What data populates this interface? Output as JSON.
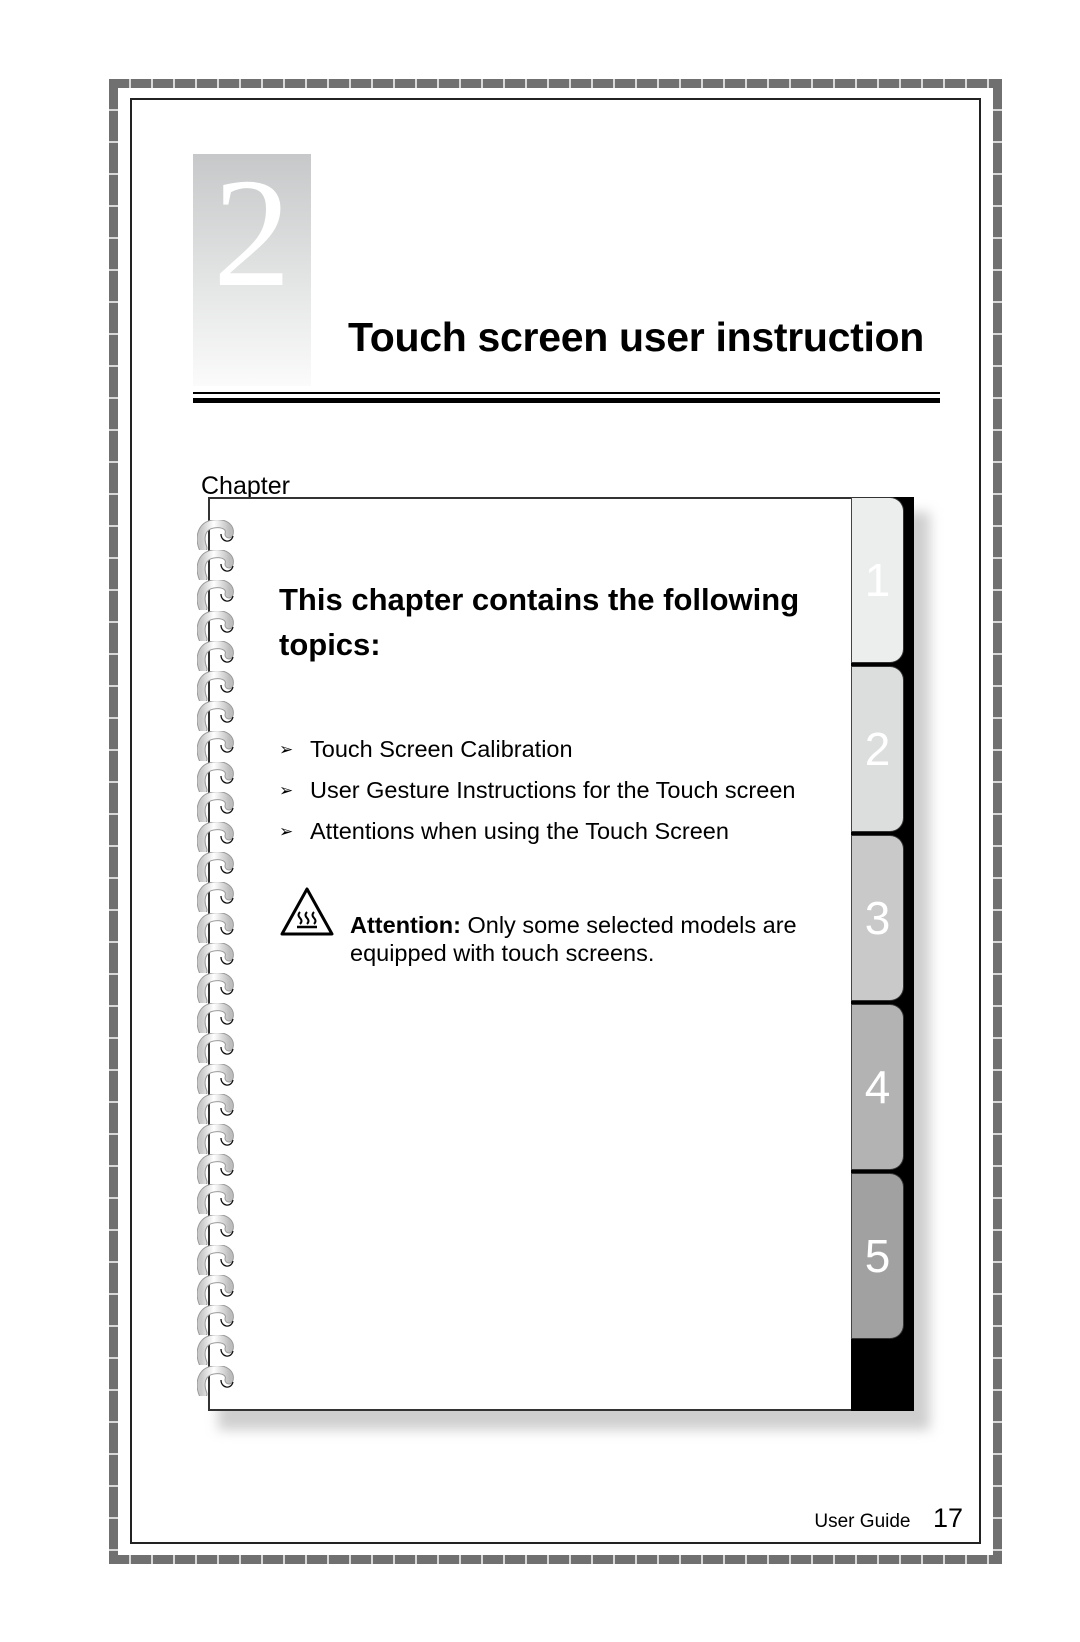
{
  "chapter": {
    "number": "2",
    "label": "Chapter",
    "title": "Touch screen user instruction"
  },
  "notebook": {
    "heading": "This chapter contains the following topics:",
    "topics": [
      {
        "bullet": "arrow-bullet-icon",
        "text": "Touch Screen Calibration"
      },
      {
        "bullet": "arrow-bullet-icon",
        "text": "User Gesture Instructions for the Touch screen"
      },
      {
        "bullet": "arrow-bullet-icon",
        "text": "Attentions when using the Touch Screen"
      }
    ],
    "attention": {
      "icon": "hot-surface-warning-icon",
      "label": "Attention:",
      "text": " Only some selected models are equipped with touch screens."
    },
    "tabs": [
      {
        "label": "1",
        "color": "#eceeee"
      },
      {
        "label": "2",
        "color": "#dcdddd"
      },
      {
        "label": "3",
        "color": "#c9c9c9"
      },
      {
        "label": "4",
        "color": "#b3b3b3"
      },
      {
        "label": "5",
        "color": "#a1a1a1"
      }
    ]
  },
  "footer": {
    "doc_name": "User Guide",
    "page_number": "17"
  }
}
